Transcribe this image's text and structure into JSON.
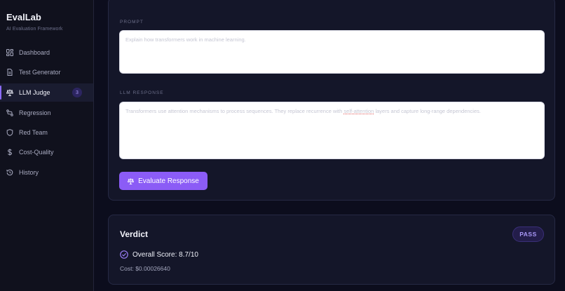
{
  "app": {
    "title": "EvalLab",
    "subtitle": "AI Evaluation Framework"
  },
  "sidebar": {
    "items": [
      {
        "label": "Dashboard",
        "icon": "grid-icon"
      },
      {
        "label": "Test Generator",
        "icon": "document-icon"
      },
      {
        "label": "LLM Judge",
        "icon": "scale-icon",
        "active": true,
        "badge": "3"
      },
      {
        "label": "Regression",
        "icon": "git-compare-icon"
      },
      {
        "label": "Red Team",
        "icon": "shield-icon"
      },
      {
        "label": "Cost-Quality",
        "icon": "dollar-icon"
      },
      {
        "label": "History",
        "icon": "history-icon"
      }
    ]
  },
  "judge": {
    "prompt_label": "PROMPT",
    "prompt_text": "Explain how transformers work in machine learning.",
    "response_label": "LLM RESPONSE",
    "response_text_a": "Transformers use attention mechanisms to process sequences. They replace recurrence with",
    "response_text_err": "self-attention",
    "response_text_b": "layers and capture long-range dependencies.",
    "evaluate_label": "Evaluate Response"
  },
  "verdict": {
    "title": "Verdict",
    "status": "PASS",
    "score_text": "Overall Score: 8.7/10",
    "cost_text": "Cost: $0.00026640"
  },
  "colors": {
    "accent": "#8b5cf6",
    "background": "#0c0d1d",
    "card": "#141629"
  }
}
